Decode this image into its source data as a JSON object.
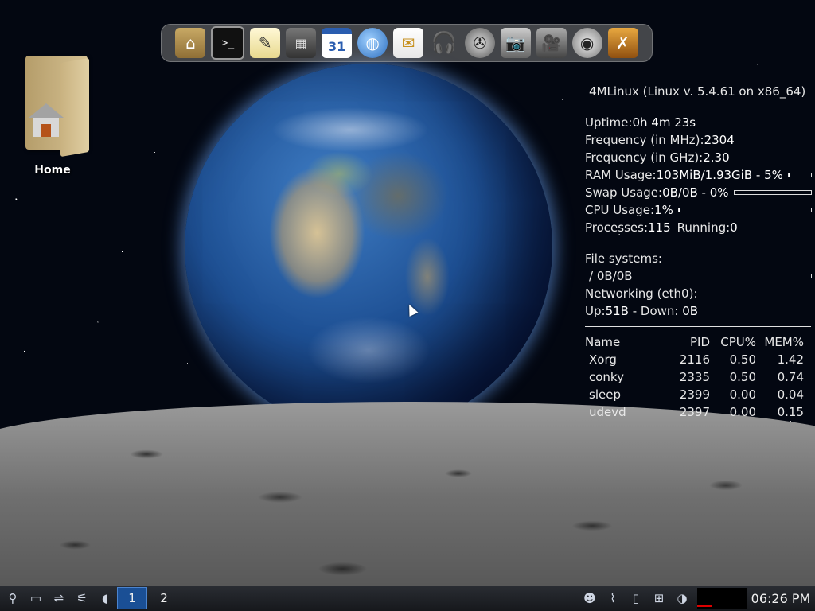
{
  "desktop": {
    "icons": [
      {
        "label": "Home",
        "icon": "home-folder-icon"
      }
    ]
  },
  "dock": {
    "items": [
      {
        "name": "home",
        "glyph": "⌂"
      },
      {
        "name": "terminal",
        "glyph": ">_"
      },
      {
        "name": "text-editor",
        "glyph": "✎"
      },
      {
        "name": "calculator",
        "glyph": "▦"
      },
      {
        "name": "calendar",
        "glyph": "31"
      },
      {
        "name": "web-browser",
        "glyph": "◍"
      },
      {
        "name": "mail",
        "glyph": "✉"
      },
      {
        "name": "audio-player",
        "glyph": "🎧"
      },
      {
        "name": "video-player",
        "glyph": "✇"
      },
      {
        "name": "screenshot",
        "glyph": "📷"
      },
      {
        "name": "video-camera",
        "glyph": "🎥"
      },
      {
        "name": "webcam",
        "glyph": "◉"
      },
      {
        "name": "games",
        "glyph": "✗"
      }
    ]
  },
  "conky": {
    "title": "4MLinux (Linux v. 5.4.61 on x86_64)",
    "uptime_label": "Uptime: ",
    "uptime": "0h 4m 23s",
    "freq_mhz_label": "Frequency (in MHz): ",
    "freq_mhz": "2304",
    "freq_ghz_label": "Frequency (in GHz): ",
    "freq_ghz": "2.30",
    "ram_label": "RAM Usage: ",
    "ram": "103MiB/1.93GiB - 5%",
    "ram_pct": 0.05,
    "swap_label": "Swap Usage: ",
    "swap": "0B/0B - 0%",
    "swap_pct": 0,
    "cpu_label": "CPU Usage: ",
    "cpu": "1%",
    "cpu_pct": 0.01,
    "processes_label": "Processes: ",
    "processes": "115",
    "running_label": "Running: ",
    "running": "0",
    "fs_label": "File systems:",
    "fs_root": "/ 0B/0B",
    "fs_pct": 0,
    "net_label": "Networking (eth0):",
    "up_label": "Up: ",
    "up": "51B",
    "down_label": " - Down: ",
    "down": "0B",
    "proc_headers": [
      "Name",
      "PID",
      "CPU%",
      "MEM%"
    ],
    "proc_rows": [
      [
        "Xorg",
        "2116",
        "0.50",
        "1.42"
      ],
      [
        "conky",
        "2335",
        "0.50",
        "0.74"
      ],
      [
        "sleep",
        "2399",
        "0.00",
        "0.04"
      ],
      [
        "udevd",
        "2397",
        "0.00",
        "0.15"
      ]
    ]
  },
  "taskbar": {
    "workspaces": [
      "1",
      "2"
    ],
    "active_workspace": "1",
    "clock": "06:26 PM"
  }
}
